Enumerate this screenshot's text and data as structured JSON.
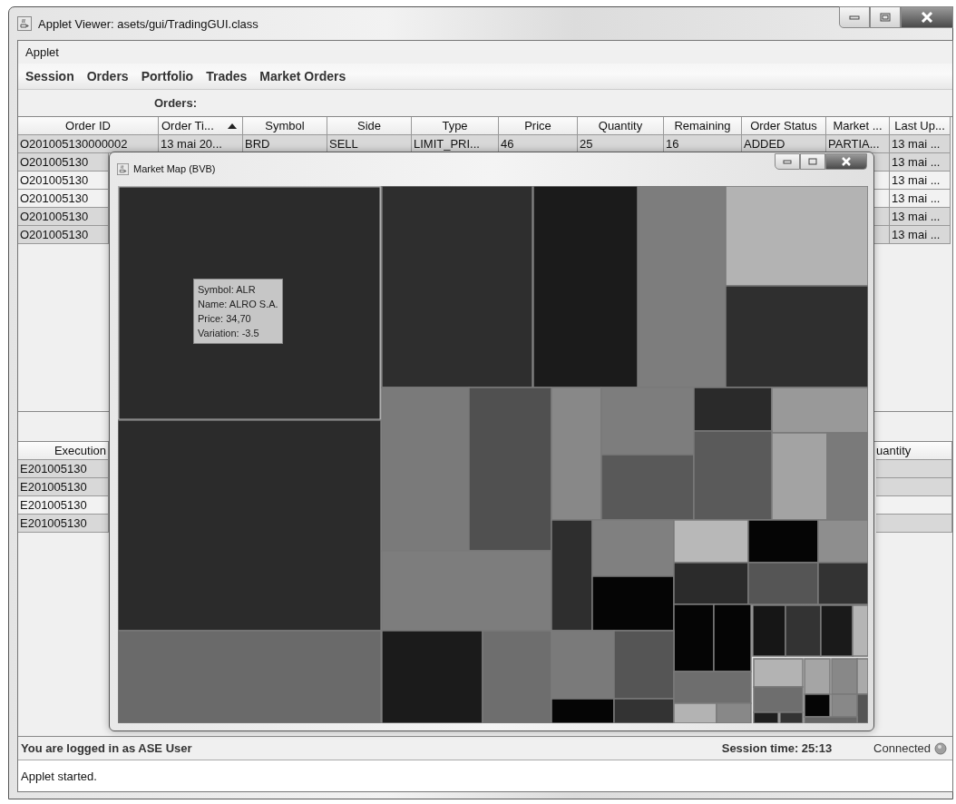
{
  "window": {
    "title": "Applet Viewer: asets/gui/TradingGUI.class"
  },
  "applet_menu": [
    "Applet"
  ],
  "menu_bar": [
    "Session",
    "Orders",
    "Portfolio",
    "Trades",
    "Market Orders"
  ],
  "orders": {
    "label": "Orders:",
    "columns": [
      {
        "label": "Order ID",
        "sorted": false
      },
      {
        "label": "Order Ti...",
        "sorted": true
      },
      {
        "label": "Symbol",
        "sorted": false
      },
      {
        "label": "Side",
        "sorted": false
      },
      {
        "label": "Type",
        "sorted": false
      },
      {
        "label": "Price",
        "sorted": false
      },
      {
        "label": "Quantity",
        "sorted": false
      },
      {
        "label": "Remaining",
        "sorted": false
      },
      {
        "label": "Order Status",
        "sorted": false
      },
      {
        "label": "Market ...",
        "sorted": false
      },
      {
        "label": "Last Up...",
        "sorted": false
      }
    ],
    "rows": [
      {
        "selected": true,
        "cells": [
          "O201005130000002",
          "13 mai 20...",
          "BRD",
          "SELL",
          "LIMIT_PRI...",
          "46",
          "25",
          "16",
          "ADDED",
          "PARTIA...",
          "13 mai ..."
        ]
      },
      {
        "selected": true,
        "cells": [
          "O201005130",
          "13 mai ..."
        ]
      },
      {
        "selected": false,
        "cells": [
          "O201005130",
          "13 mai ..."
        ]
      },
      {
        "selected": false,
        "cells": [
          "O201005130",
          "13 mai ..."
        ]
      },
      {
        "selected": true,
        "cells": [
          "O201005130",
          "13 mai ..."
        ]
      },
      {
        "selected": true,
        "cells": [
          "O201005130",
          "13 mai ..."
        ]
      }
    ]
  },
  "executions": {
    "columns": [
      "Execution",
      "uantity"
    ],
    "rows": [
      {
        "selected": true,
        "cells": [
          "E201005130"
        ]
      },
      {
        "selected": true,
        "cells": [
          "E201005130"
        ]
      },
      {
        "selected": false,
        "cells": [
          "E201005130"
        ]
      },
      {
        "selected": true,
        "cells": [
          "E201005130"
        ]
      }
    ]
  },
  "market_map": {
    "title": "Market Map (BVB)",
    "tooltip": [
      "Symbol: ALR",
      "Name: ALRO S.A.",
      "Price: 34,70",
      "Variation: -3.5"
    ]
  },
  "status_bar": {
    "user": "You are logged in as ASE User",
    "session_time": "Session time: 25:13",
    "connection": "Connected"
  },
  "applet_status": "Applet started."
}
